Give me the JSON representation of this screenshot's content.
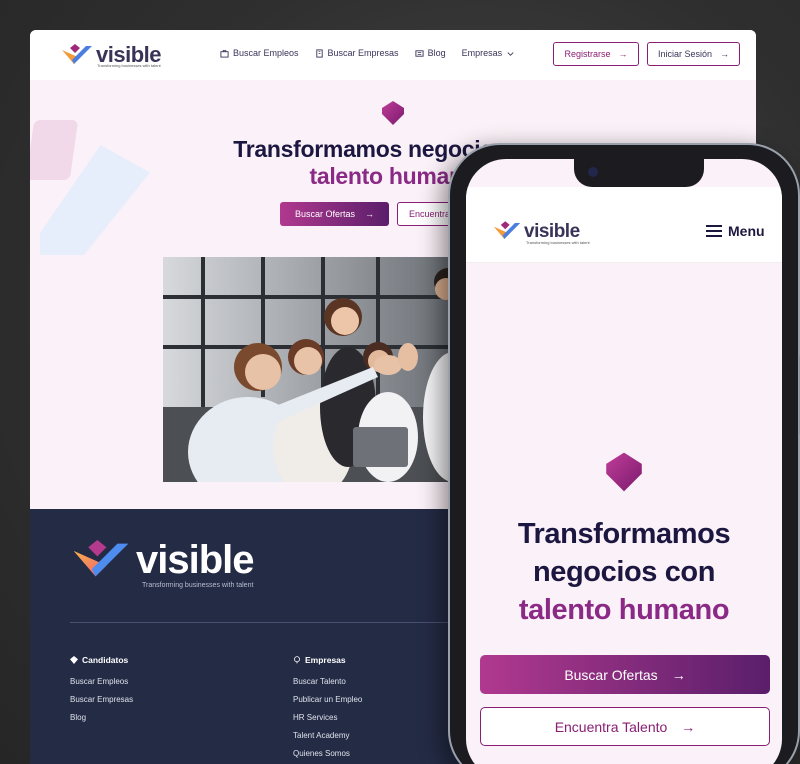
{
  "brand": {
    "name": "visible",
    "tagline": "Transforming businesses with talent"
  },
  "desktop_nav": {
    "links": [
      {
        "label": "Buscar Empleos",
        "icon": "briefcase-icon"
      },
      {
        "label": "Buscar Empresas",
        "icon": "building-icon"
      },
      {
        "label": "Blog",
        "icon": "newspaper-icon"
      },
      {
        "label": "Empresas",
        "icon": "chevron-down-icon"
      }
    ],
    "register_label": "Registrarse",
    "login_label": "Iniciar Sesión"
  },
  "hero": {
    "line1": "Transformamos negocios con",
    "line2": "talento humano",
    "cta_primary": "Buscar Ofertas",
    "cta_secondary": "Encuentra Talento"
  },
  "footer": {
    "tagline": "Transforming businesses with talent",
    "col1": {
      "title": "Candidatos",
      "items": [
        "Buscar Empleos",
        "Buscar Empresas",
        "Blog"
      ]
    },
    "col2": {
      "title": "Empresas",
      "items": [
        "Buscar Talento",
        "Publicar un Empleo",
        "HR Services",
        "Talent Academy",
        "Quienes Somos"
      ]
    }
  },
  "mobile": {
    "menu_label": "Menu",
    "hero_line1": "Transformamos",
    "hero_line2": "negocios con",
    "hero_line3": "talento humano"
  },
  "colors": {
    "primary": "#8a1e74",
    "dark": "#1c1740",
    "footer_bg": "#242b45",
    "hero_bg": "#fbf1f8"
  }
}
